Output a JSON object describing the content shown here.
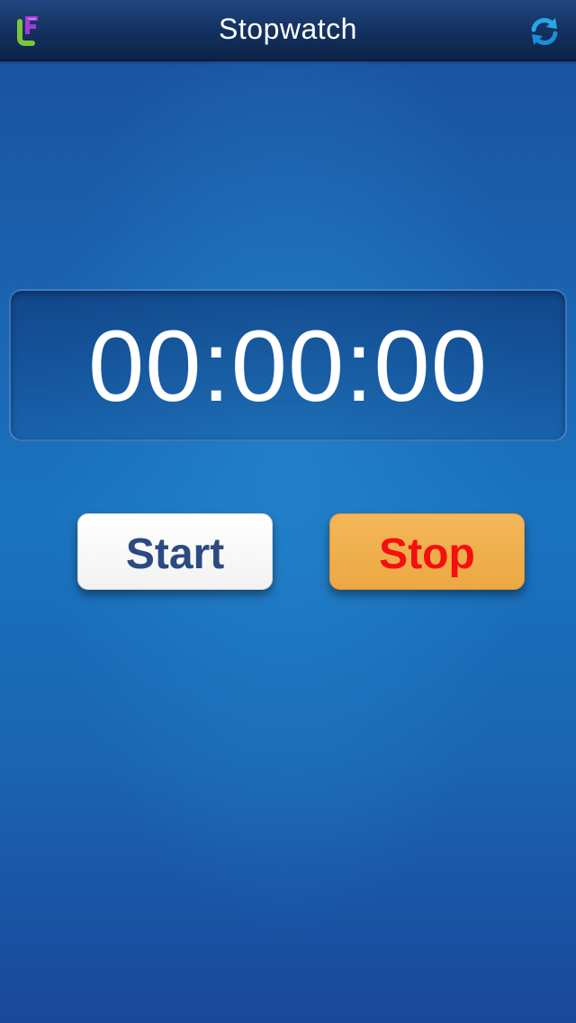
{
  "navbar": {
    "title": "Stopwatch",
    "logo_icon": "app-logo-icon",
    "refresh_icon": "refresh-icon"
  },
  "display": {
    "time": "00:00:00"
  },
  "buttons": {
    "start_label": "Start",
    "stop_label": "Stop"
  },
  "colors": {
    "navbar": "#13305e",
    "background": "#1a64b0",
    "start_text": "#2c4a82",
    "stop_bg": "#f0b04e",
    "stop_text": "#f50f0f"
  }
}
